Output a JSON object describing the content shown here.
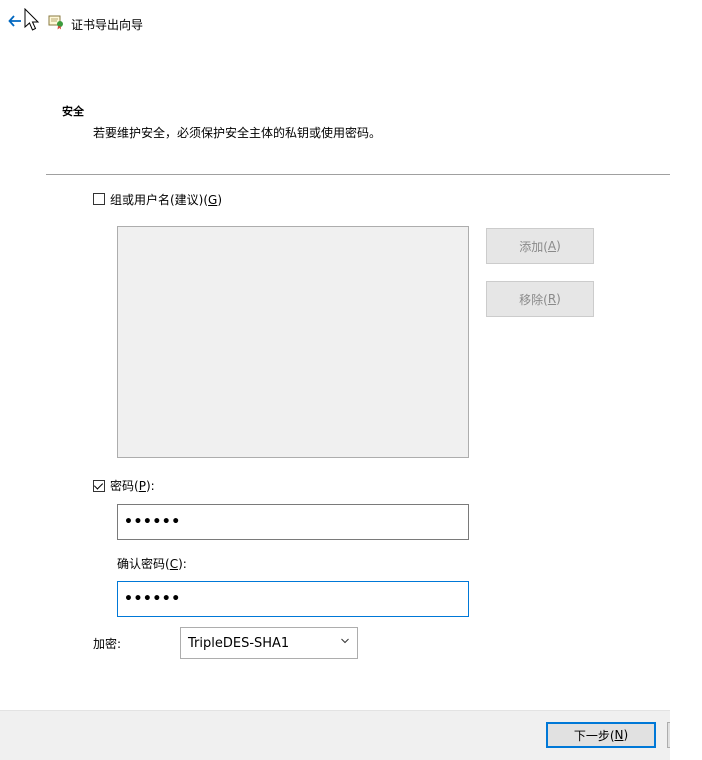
{
  "window": {
    "title": "证书导出向导"
  },
  "header": {
    "section_title": "安全",
    "description": "若要维护安全，必须保护安全主体的私钥或使用密码。"
  },
  "group_option": {
    "label_prefix": "组或用户名(建议)(",
    "label_key": "G",
    "label_suffix": ")",
    "checked": false
  },
  "principals_list": {
    "items": []
  },
  "buttons": {
    "add_prefix": "添加(",
    "add_key": "A",
    "add_suffix": ")",
    "remove_prefix": "移除(",
    "remove_key": "R",
    "remove_suffix": ")",
    "next_prefix": "下一步(",
    "next_key": "N",
    "next_suffix": ")"
  },
  "password_option": {
    "label_prefix": "密码(",
    "label_key": "P",
    "label_suffix": "):",
    "checked": true,
    "value": "••••••"
  },
  "confirm_password": {
    "label_prefix": "确认密码(",
    "label_key": "C",
    "label_suffix": "):",
    "value": "••••••"
  },
  "encryption": {
    "label": "加密:",
    "selected": "TripleDES-SHA1"
  },
  "icons": {
    "back": "back-arrow-icon",
    "cursor": "mouse-cursor-icon",
    "wizard": "certificate-wizard-icon",
    "dropdown": "chevron-down-icon"
  },
  "colors": {
    "focus_accent": "#0078d7",
    "disabled_button": "#e6e6e6",
    "list_background": "#f0f0f0"
  }
}
